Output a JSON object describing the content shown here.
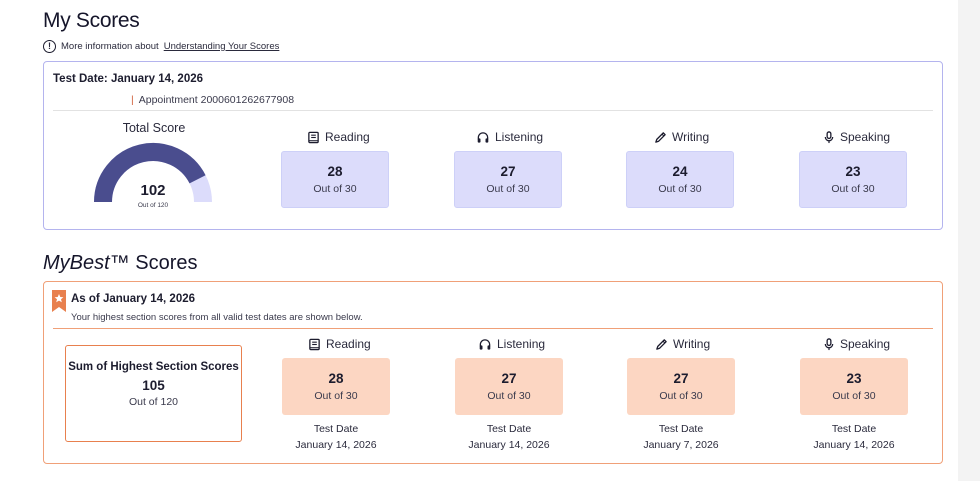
{
  "page": {
    "title": "My Scores"
  },
  "info": {
    "prefix": "More information about",
    "link": "Understanding Your Scores"
  },
  "my_scores": {
    "test_date": "Test Date: January 14, 2026",
    "appointment": "Appointment 2000601262677908",
    "total": {
      "label": "Total Score",
      "score": "102",
      "out_of": "Out of 120",
      "fraction": 0.85
    },
    "sections": [
      {
        "name": "Reading",
        "icon": "book-icon",
        "score": "28",
        "out_of": "Out of 30"
      },
      {
        "name": "Listening",
        "icon": "headphones-icon",
        "score": "27",
        "out_of": "Out of 30"
      },
      {
        "name": "Writing",
        "icon": "pencil-icon",
        "score": "24",
        "out_of": "Out of 30"
      },
      {
        "name": "Speaking",
        "icon": "microphone-icon",
        "score": "23",
        "out_of": "Out of 30"
      }
    ]
  },
  "mybest": {
    "title_italic": "MyBest™",
    "title_rest": " Scores",
    "as_of": "As of January 14, 2026",
    "subtitle": "Your highest section scores from all valid test dates are shown below.",
    "sum": {
      "label": "Sum of Highest Section Scores",
      "score": "105",
      "out_of": "Out of 120"
    },
    "sections": [
      {
        "name": "Reading",
        "score": "28",
        "out_of": "Out of 30",
        "date_label": "Test Date",
        "date": "January 14, 2026"
      },
      {
        "name": "Listening",
        "score": "27",
        "out_of": "Out of 30",
        "date_label": "Test Date",
        "date": "January 14, 2026"
      },
      {
        "name": "Writing",
        "score": "27",
        "out_of": "Out of 30",
        "date_label": "Test Date",
        "date": "January 7, 2026"
      },
      {
        "name": "Speaking",
        "score": "23",
        "out_of": "Out of 30",
        "date_label": "Test Date",
        "date": "January 14, 2026"
      }
    ]
  },
  "colors": {
    "gauge_fill": "#4a4d8e",
    "gauge_track": "#dcdcfb",
    "score_box_blue": "#dcdcfb",
    "score_box_peach": "#fcd6c2",
    "mybest_accent": "#e8804e"
  }
}
